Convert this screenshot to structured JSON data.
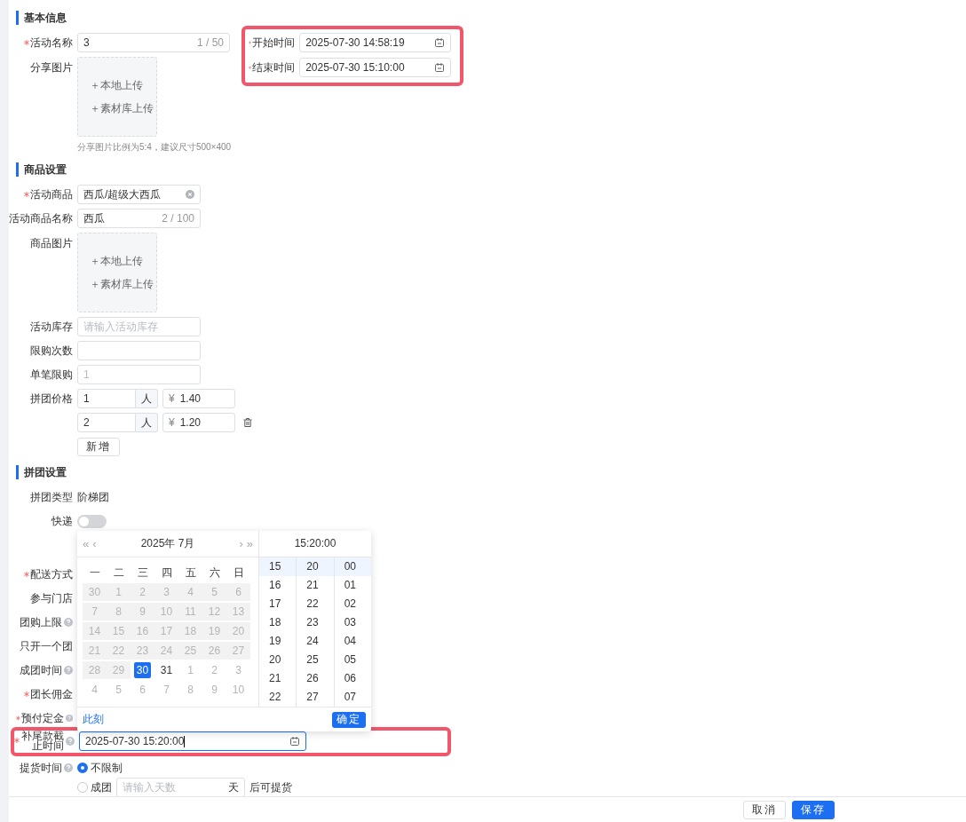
{
  "basic": {
    "title": "基本信息",
    "name": {
      "label": "活动名称",
      "required": true,
      "value": "3",
      "count": "1 / 50"
    },
    "start": {
      "label": "开始时间",
      "required": true,
      "value": "2025-07-30 14:58:19"
    },
    "end": {
      "label": "结束时间",
      "required": true,
      "value": "2025-07-30 15:10:00"
    },
    "share": {
      "label": "分享图片",
      "uploads": [
        "＋本地上传",
        "＋素材库上传"
      ],
      "hint": "分享图片比例为5:4，建议尺寸500×400"
    }
  },
  "goods": {
    "title": "商品设置",
    "product": {
      "label": "活动商品",
      "required": true,
      "value": "西瓜/超级大西瓜"
    },
    "product_name": {
      "label": "活动商品名称",
      "required": false,
      "value": "西瓜",
      "count": "2 / 100"
    },
    "image": {
      "label": "商品图片",
      "uploads": [
        "＋本地上传",
        "＋素材库上传"
      ]
    },
    "stock": {
      "label": "活动库存",
      "placeholder": "请输入活动库存"
    },
    "limit": {
      "label": "限购次数"
    },
    "single": {
      "label": "单笔限购",
      "placeholder": "1"
    },
    "price": {
      "label": "拼团价格",
      "tiers": [
        {
          "people": "1",
          "unit": "人",
          "currency": "¥",
          "price": "1.40",
          "deletable": false
        },
        {
          "people": "2",
          "unit": "人",
          "currency": "¥",
          "price": "1.20",
          "deletable": true
        }
      ],
      "add": "新增"
    }
  },
  "group": {
    "title": "拼团设置",
    "type": {
      "label": "拼团类型",
      "value": "阶梯团"
    },
    "express": {
      "label": "快递",
      "on": false
    },
    "rows": [
      {
        "label": "配送方式",
        "required": true,
        "help": false
      },
      {
        "label": "参与门店",
        "required": false,
        "help": false
      },
      {
        "label": "团购上限",
        "required": false,
        "help": true
      },
      {
        "label": "只开一个团",
        "required": false,
        "help": false
      },
      {
        "label": "成团时间",
        "required": false,
        "help": true
      },
      {
        "label": "团长佣金",
        "required": true,
        "help": false
      },
      {
        "label": "预付定金",
        "required": true,
        "help": true
      }
    ],
    "deadline": {
      "label": "补尾款截止时间",
      "required": true,
      "help": true,
      "value": "2025-07-30 15:20:00"
    },
    "pickup": {
      "label": "提货时间",
      "help": true,
      "options": [
        {
          "label": "不限制",
          "selected": true
        },
        {
          "label": "成团",
          "selected": false,
          "placeholder": "请输入天数",
          "unit": "天",
          "suffix": "后可提货"
        }
      ]
    }
  },
  "picker": {
    "nav": [
      "«",
      "‹",
      "›",
      "»"
    ],
    "month": "2025年 7月",
    "time": "15:20:00",
    "weekdays": [
      "一",
      "二",
      "三",
      "四",
      "五",
      "六",
      "日"
    ],
    "days": [
      {
        "text": "30",
        "kind": "disabled"
      },
      {
        "text": "1",
        "kind": "disabled"
      },
      {
        "text": "2",
        "kind": "disabled"
      },
      {
        "text": "3",
        "kind": "disabled"
      },
      {
        "text": "4",
        "kind": "disabled"
      },
      {
        "text": "5",
        "kind": "disabled"
      },
      {
        "text": "6",
        "kind": "disabled"
      },
      {
        "text": "7",
        "kind": "disabled"
      },
      {
        "text": "8",
        "kind": "disabled"
      },
      {
        "text": "9",
        "kind": "disabled"
      },
      {
        "text": "10",
        "kind": "disabled"
      },
      {
        "text": "11",
        "kind": "disabled"
      },
      {
        "text": "12",
        "kind": "disabled"
      },
      {
        "text": "13",
        "kind": "disabled"
      },
      {
        "text": "14",
        "kind": "disabled"
      },
      {
        "text": "15",
        "kind": "disabled"
      },
      {
        "text": "16",
        "kind": "disabled"
      },
      {
        "text": "17",
        "kind": "disabled"
      },
      {
        "text": "18",
        "kind": "disabled"
      },
      {
        "text": "19",
        "kind": "disabled"
      },
      {
        "text": "20",
        "kind": "disabled"
      },
      {
        "text": "21",
        "kind": "disabled"
      },
      {
        "text": "22",
        "kind": "disabled"
      },
      {
        "text": "23",
        "kind": "disabled"
      },
      {
        "text": "24",
        "kind": "disabled"
      },
      {
        "text": "25",
        "kind": "disabled"
      },
      {
        "text": "26",
        "kind": "disabled"
      },
      {
        "text": "27",
        "kind": "disabled"
      },
      {
        "text": "28",
        "kind": "disabled"
      },
      {
        "text": "29",
        "kind": "disabled"
      },
      {
        "text": "30",
        "kind": "selected"
      },
      {
        "text": "31",
        "kind": "normal"
      },
      {
        "text": "1",
        "kind": "other"
      },
      {
        "text": "2",
        "kind": "other"
      },
      {
        "text": "3",
        "kind": "other"
      },
      {
        "text": "4",
        "kind": "other"
      },
      {
        "text": "5",
        "kind": "other"
      },
      {
        "text": "6",
        "kind": "other"
      },
      {
        "text": "7",
        "kind": "other"
      },
      {
        "text": "8",
        "kind": "other"
      },
      {
        "text": "9",
        "kind": "other"
      },
      {
        "text": "10",
        "kind": "other"
      }
    ],
    "columns": [
      [
        {
          "text": "15",
          "selected": true
        },
        {
          "text": "16",
          "selected": false
        },
        {
          "text": "17",
          "selected": false
        },
        {
          "text": "18",
          "selected": false
        },
        {
          "text": "19",
          "selected": false
        },
        {
          "text": "20",
          "selected": false
        },
        {
          "text": "21",
          "selected": false
        },
        {
          "text": "22",
          "selected": false
        }
      ],
      [
        {
          "text": "20",
          "selected": true
        },
        {
          "text": "21",
          "selected": false
        },
        {
          "text": "22",
          "selected": false
        },
        {
          "text": "23",
          "selected": false
        },
        {
          "text": "24",
          "selected": false
        },
        {
          "text": "25",
          "selected": false
        },
        {
          "text": "26",
          "selected": false
        },
        {
          "text": "27",
          "selected": false
        }
      ],
      [
        {
          "text": "00",
          "selected": true
        },
        {
          "text": "01",
          "selected": false
        },
        {
          "text": "02",
          "selected": false
        },
        {
          "text": "03",
          "selected": false
        },
        {
          "text": "04",
          "selected": false
        },
        {
          "text": "05",
          "selected": false
        },
        {
          "text": "06",
          "selected": false
        },
        {
          "text": "07",
          "selected": false
        }
      ]
    ],
    "now": "此刻",
    "ok": "确定"
  },
  "footer": {
    "cancel": "取消",
    "save": "保存"
  }
}
